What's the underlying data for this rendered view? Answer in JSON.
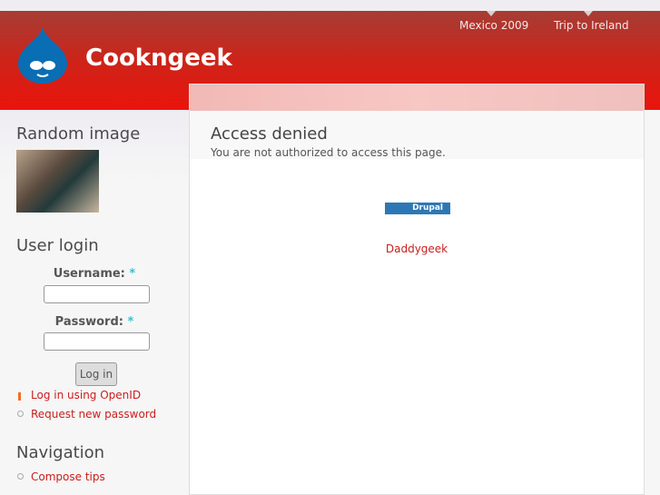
{
  "site": {
    "name": "Cookngeek"
  },
  "primary_links": [
    "Mexico 2009",
    "Trip to Ireland"
  ],
  "sidebar": {
    "random_image_title": "Random image",
    "login_title": "User login",
    "username_label": "Username:",
    "password_label": "Password:",
    "required": "*",
    "login_button": "Log in",
    "openid_link": "Log in using OpenID",
    "request_password": "Request new password",
    "nav_title": "Navigation",
    "nav_items": [
      "Compose tips"
    ]
  },
  "main": {
    "title": "Access denied",
    "message": "You are not authorized to access this page.",
    "badge": "Drupal",
    "footer_link": "Daddygeek"
  }
}
